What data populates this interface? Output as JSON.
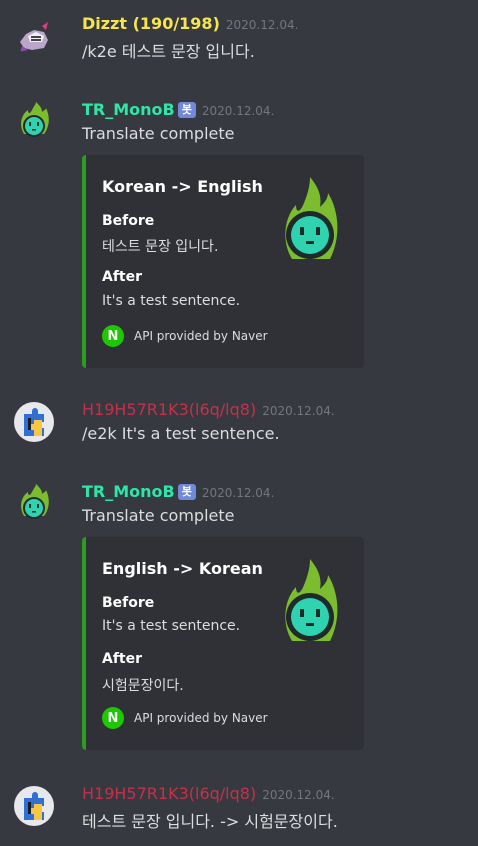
{
  "messages": [
    {
      "username": "Dizzt (190/198)",
      "username_color": "#f6e54b",
      "timestamp": "2020.12.04.",
      "content": "/k2e 테스트 문장 입니다."
    },
    {
      "username": "TR_MonoB",
      "username_color": "#2ee6a6",
      "bot_badge": "봇",
      "timestamp": "2020.12.04.",
      "content": "Translate complete",
      "embed": {
        "title": "Korean -> English",
        "field1_name": "Before",
        "field1_value": "테스트 문장 입니다.",
        "field2_name": "After",
        "field2_value": "It's a test sentence.",
        "footer_icon": "N",
        "footer_text": "API provided by Naver"
      }
    },
    {
      "username": "H19H57R1K3(l6q/lq8)",
      "username_color": "#c4314b",
      "timestamp": "2020.12.04.",
      "content": "/e2k It's a test sentence."
    },
    {
      "username": "TR_MonoB",
      "username_color": "#2ee6a6",
      "bot_badge": "봇",
      "timestamp": "2020.12.04.",
      "content": "Translate complete",
      "embed": {
        "title": "English -> Korean",
        "field1_name": "Before",
        "field1_value": "It's a test sentence.",
        "field2_name": "After",
        "field2_value": "시험문장이다.",
        "footer_icon": "N",
        "footer_text": "API provided by Naver"
      }
    },
    {
      "username": "H19H57R1K3(l6q/lq8)",
      "username_color": "#c4314b",
      "timestamp": "2020.12.04.",
      "content": "테스트 문장 입니다. -> 시험문장이다."
    }
  ],
  "icons": {
    "dizzt_avatar": "knight-avatar-icon",
    "bot_avatar": "green-flame-avatar-icon",
    "h19_avatar": "puzzle-piece-avatar-icon",
    "naver": "naver-logo-icon"
  },
  "colors": {
    "background": "#36393f",
    "embed_background": "#2f3136",
    "embed_accent": "#2a9d1f",
    "bot_badge": "#7289da"
  }
}
